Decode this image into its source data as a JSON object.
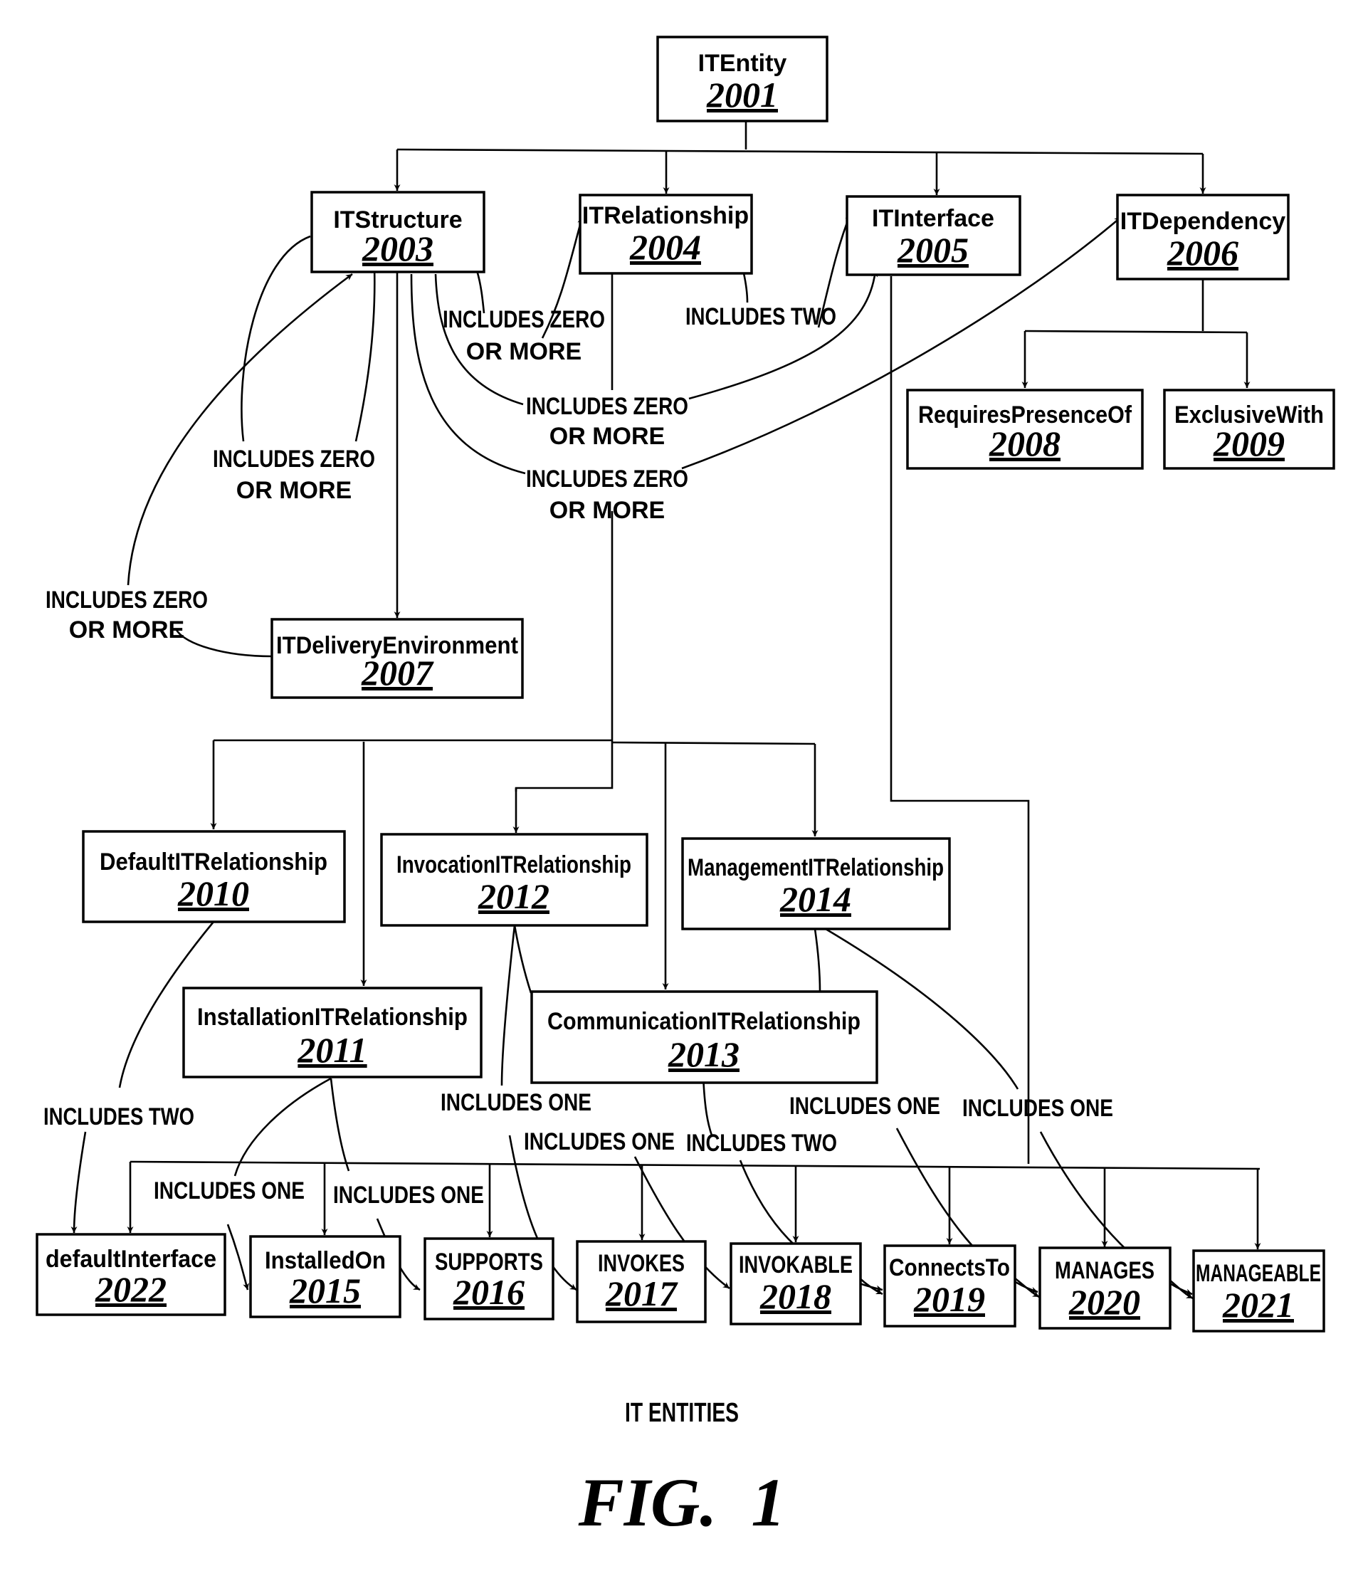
{
  "caption": "IT ENTITIES",
  "figure_label": "FIG.  1",
  "nodes": [
    {
      "id": "2001",
      "name": "ITEntity",
      "num": "2001"
    },
    {
      "id": "2003",
      "name": "ITStructure",
      "num": "2003"
    },
    {
      "id": "2004",
      "name": "ITRelationship",
      "num": "2004"
    },
    {
      "id": "2005",
      "name": "ITInterface",
      "num": "2005"
    },
    {
      "id": "2006",
      "name": "ITDependency",
      "num": "2006"
    },
    {
      "id": "2007",
      "name": "ITDeliveryEnvironment",
      "num": "2007"
    },
    {
      "id": "2008",
      "name": "RequiresPresenceOf",
      "num": "2008"
    },
    {
      "id": "2009",
      "name": "ExclusiveWith",
      "num": "2009"
    },
    {
      "id": "2010",
      "name": "DefaultITRelationship",
      "num": "2010"
    },
    {
      "id": "2011",
      "name": "InstallationITRelationship",
      "num": "2011"
    },
    {
      "id": "2012",
      "name": "InvocationITRelationship",
      "num": "2012"
    },
    {
      "id": "2013",
      "name": "CommunicationITRelationship",
      "num": "2013"
    },
    {
      "id": "2014",
      "name": "ManagementITRelationship",
      "num": "2014"
    },
    {
      "id": "2022",
      "name": "defaultInterface",
      "num": "2022"
    },
    {
      "id": "2015",
      "name": "InstalledOn",
      "num": "2015"
    },
    {
      "id": "2016",
      "name": "SUPPORTS",
      "num": "2016"
    },
    {
      "id": "2017",
      "name": "INVOKES",
      "num": "2017"
    },
    {
      "id": "2018",
      "name": "INVOKABLE",
      "num": "2018"
    },
    {
      "id": "2019",
      "name": "ConnectsTo",
      "num": "2019"
    },
    {
      "id": "2020",
      "name": "MANAGES",
      "num": "2020"
    },
    {
      "id": "2021",
      "name": "MANAGEABLE",
      "num": "2021"
    }
  ],
  "edge_labels": [
    {
      "text": [
        "INCLUDES ZERO",
        "OR MORE"
      ],
      "desc": "ITStructure includes ITRelationship"
    },
    {
      "text": [
        "INCLUDES TWO"
      ],
      "desc": "ITRelationship includes ITInterface"
    },
    {
      "text": [
        "INCLUDES ZERO",
        "OR MORE"
      ],
      "desc": "ITStructure includes ITInterface"
    },
    {
      "text": [
        "INCLUDES ZERO",
        "OR MORE"
      ],
      "desc": "ITStructure includes ITDependency"
    },
    {
      "text": [
        "INCLUDES ZERO",
        "OR MORE"
      ],
      "desc": "ITStructure includes ITStructure"
    },
    {
      "text": [
        "INCLUDES ZERO",
        "OR MORE"
      ],
      "desc": "ITDeliveryEnvironment includes ITStructure"
    },
    {
      "text": [
        "INCLUDES TWO"
      ],
      "desc": "DefaultITRelationship includes defaultInterface"
    },
    {
      "text": [
        "INCLUDES ONE"
      ],
      "desc": "InstallationITRelationship includes InstalledOn"
    },
    {
      "text": [
        "INCLUDES ONE"
      ],
      "desc": "InstallationITRelationship includes SUPPORTS"
    },
    {
      "text": [
        "INCLUDES ONE"
      ],
      "desc": "InvocationITRelationship includes INVOKES"
    },
    {
      "text": [
        "INCLUDES ONE"
      ],
      "desc": "InvocationITRelationship includes INVOKABLE"
    },
    {
      "text": [
        "INCLUDES TWO"
      ],
      "desc": "CommunicationITRelationship includes ConnectsTo"
    },
    {
      "text": [
        "INCLUDES ONE"
      ],
      "desc": "ManagementITRelationship includes MANAGES"
    },
    {
      "text": [
        "INCLUDES ONE"
      ],
      "desc": "ManagementITRelationship includes MANAGEABLE"
    }
  ]
}
